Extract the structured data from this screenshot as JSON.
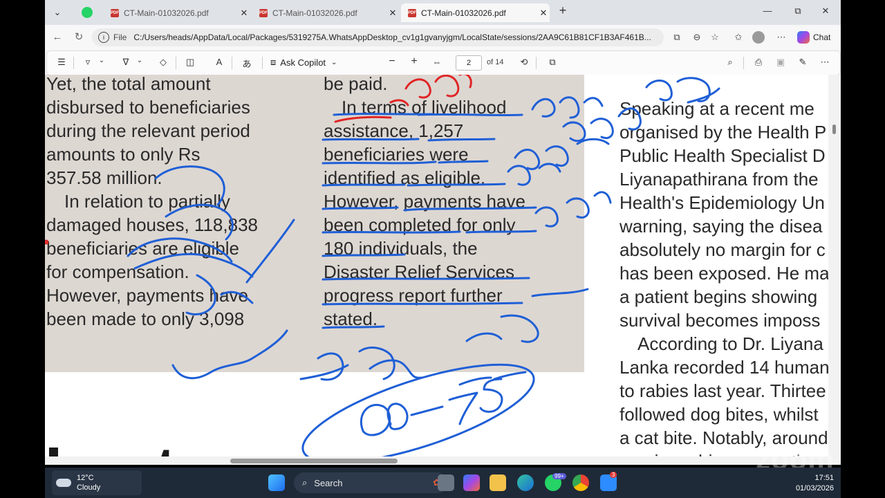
{
  "browser": {
    "tabs": [
      {
        "label": "CT-Main-01032026.pdf",
        "active": false
      },
      {
        "label": "CT-Main-01032026.pdf",
        "active": false
      },
      {
        "label": "CT-Main-01032026.pdf",
        "active": true
      }
    ],
    "new_tab": "+",
    "window_controls": {
      "minimize": "—",
      "restore": "⧉",
      "close": "✕"
    },
    "address": {
      "scheme_label": "File",
      "url": "C:/Users/heads/AppData/Local/Packages/5319275A.WhatsAppDesktop_cv1g1gvanyjgm/LocalState/sessions/2AA9C61B81CF1B3AF461B..."
    },
    "chat_label": "Chat"
  },
  "pdf_toolbar": {
    "ask_copilot": "Ask Copilot",
    "page_current": "2",
    "page_total": "of 14",
    "zoom_out": "−",
    "zoom_in": "+"
  },
  "document": {
    "col1": [
      "Yet, the total amount",
      "disbursed to beneficiaries",
      "during the relevant period",
      "amounts to only Rs",
      "357.58 million.",
      "In relation to partially",
      "damaged houses, 118,838",
      "beneficiaries are eligible",
      "for compensation.",
      "However, payments have",
      "been made to only 3,098"
    ],
    "col2": [
      "be paid.",
      "In terms of livelihood",
      "assistance, 1,257",
      "beneficiaries were",
      "identified as eligible.",
      "However, payments have",
      "been completed for only",
      "180 individuals, the",
      "Disaster Relief Services",
      "progress report further",
      "stated."
    ],
    "col3": [
      "Speaking at a recent me",
      "organised by the Health P",
      "Public Health Specialist D",
      "Liyanapathirana from the",
      "Health's Epidemiology Un",
      "warning, saying the disea",
      "absolutely no margin for c",
      "has been exposed. He ma",
      "a patient begins showing",
      "survival becomes imposs",
      "According to Dr. Liyana",
      "Lanka recorded 14 human",
      "to rabies last year. Thirtee",
      "followed dog bites, whilst",
      "a cat bite. Notably, around",
      "receive rabies preventio"
    ],
    "headline": "Lost reven",
    "annotation_number": "60–75"
  },
  "watermark": "zoom",
  "taskbar": {
    "weather_temp": "12°C",
    "weather_desc": "Cloudy",
    "search_label": "Search",
    "whatsapp_badge": "99+",
    "zoom_badge": "3",
    "time": "17:51",
    "date": "01/03/2026"
  },
  "colors": {
    "ink_blue": "#1f5fd6",
    "ink_red": "#e02525",
    "paper_shade": "#ddd7d2"
  }
}
